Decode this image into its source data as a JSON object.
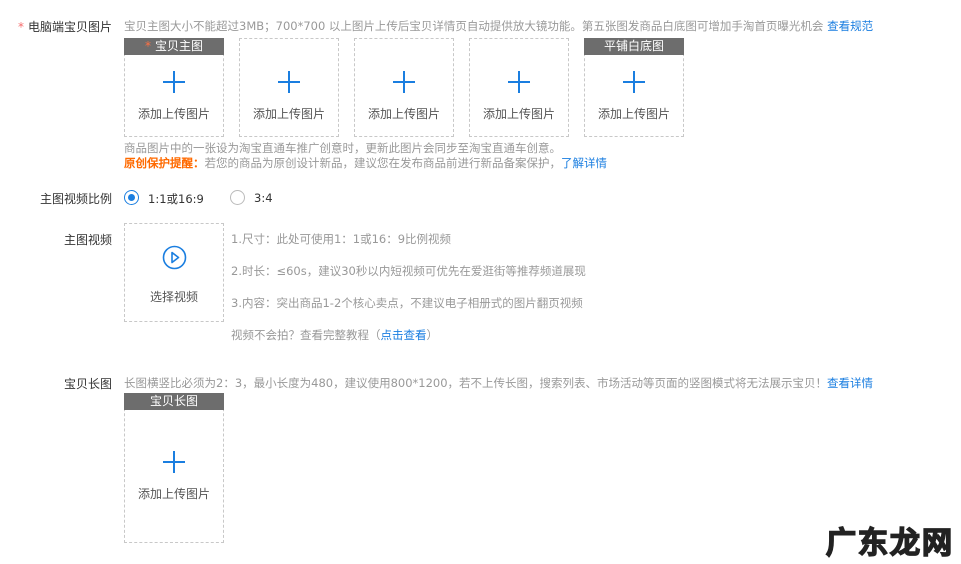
{
  "pc_images": {
    "label": "电脑端宝贝图片",
    "hint": "宝贝主图大小不能超过3MB；700*700 以上图片上传后宝贝详情页自动提供放大镜功能。第五张图发商品白底图可增加手淘首页曝光机会",
    "hint_link": "查看规范",
    "slots": [
      {
        "header": "宝贝主图",
        "required": true,
        "text": "添加上传图片"
      },
      {
        "header": "",
        "required": false,
        "text": "添加上传图片"
      },
      {
        "header": "",
        "required": false,
        "text": "添加上传图片"
      },
      {
        "header": "",
        "required": false,
        "text": "添加上传图片"
      },
      {
        "header": "平铺白底图",
        "required": false,
        "text": "添加上传图片"
      }
    ],
    "note1": "商品图片中的一张设为淘宝直通车推广创意时，更新此图片会同步至淘宝直通车创意。",
    "note2_title": "原创保护提醒：",
    "note2": "若您的商品为原创设计新品，建议您在发布商品前进行新品备案保护，",
    "note2_link": "了解详情"
  },
  "video_ratio": {
    "label": "主图视频比例",
    "options": [
      {
        "label": "1:1或16:9",
        "selected": true
      },
      {
        "label": "3:4",
        "selected": false
      }
    ]
  },
  "video": {
    "label": "主图视频",
    "button": "选择视频",
    "tips": [
      "1.尺寸：此处可使用1：1或16：9比例视频",
      "2.时长：≤60s，建议30秒以内短视频可优先在爱逛街等推荐频道展现",
      "3.内容：突出商品1-2个核心卖点，不建议电子相册式的图片翻页视频"
    ],
    "tutorial": "视频不会拍？查看完整教程（",
    "tutorial_link": "点击查看",
    "tutorial_end": "）"
  },
  "long_image": {
    "label": "宝贝长图",
    "hint": "长图横竖比必须为2：3，最小长度为480，建议使用800*1200，若不上传长图，搜索列表、市场活动等页面的竖图模式将无法展示宝贝！",
    "hint_link": "查看详情",
    "header": "宝贝长图",
    "text": "添加上传图片"
  },
  "watermark": "广东龙网"
}
